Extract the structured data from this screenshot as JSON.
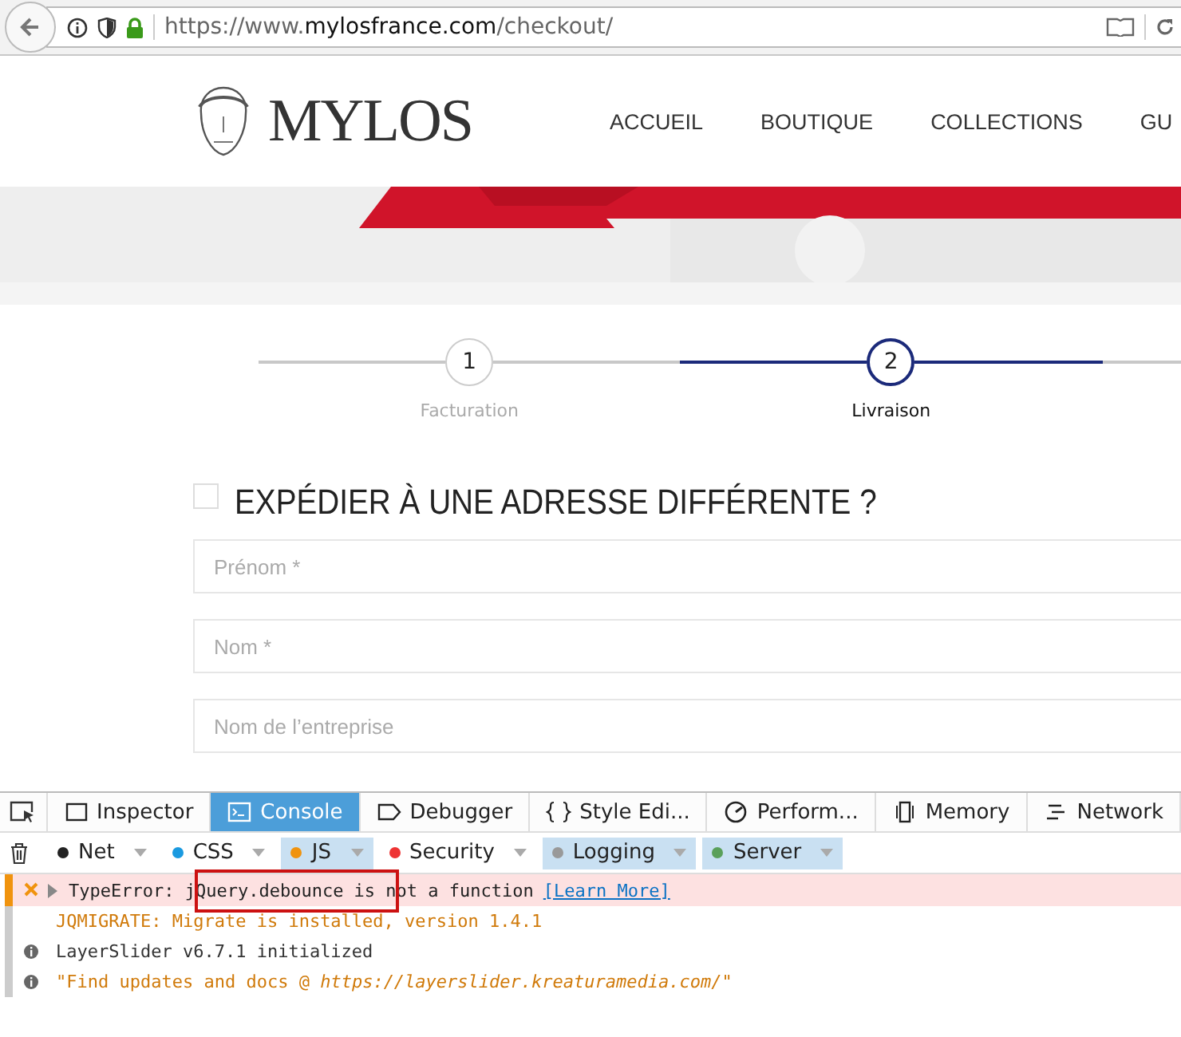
{
  "browser": {
    "url_prefix": "https://www.",
    "url_domain": "mylosfrance.com",
    "url_path": "/checkout/"
  },
  "site": {
    "logo": "MYLOS",
    "nav": [
      "ACCUEIL",
      "BOUTIQUE",
      "COLLECTIONS",
      "GU"
    ]
  },
  "steps": [
    {
      "number": "1",
      "label": "Facturation",
      "selected": false
    },
    {
      "number": "2",
      "label": "Livraison",
      "selected": true
    }
  ],
  "ship_elsewhere": {
    "label": "EXPÉDIER À UNE ADRESSE DIFFÉRENTE ?",
    "checked": false
  },
  "fields": [
    {
      "placeholder": "Prénom *"
    },
    {
      "placeholder": "Nom *"
    },
    {
      "placeholder": "Nom de l’entreprise"
    }
  ],
  "devtools": {
    "tabs": [
      {
        "label": "Inspector",
        "kind": "inspector",
        "selected": false
      },
      {
        "label": "Console",
        "kind": "console",
        "selected": true
      },
      {
        "label": "Debugger",
        "kind": "debugger",
        "selected": false
      },
      {
        "label": "Style Edi...",
        "kind": "style",
        "selected": false
      },
      {
        "label": "Perform...",
        "kind": "perf",
        "selected": false
      },
      {
        "label": "Memory",
        "kind": "memory",
        "selected": false
      },
      {
        "label": "Network",
        "kind": "network",
        "selected": false
      }
    ],
    "filters": [
      {
        "label": "Net",
        "color": "#222222",
        "selected": false
      },
      {
        "label": "CSS",
        "color": "#1a9ae0",
        "selected": false
      },
      {
        "label": "JS",
        "color": "#f0930e",
        "selected": true
      },
      {
        "label": "Security",
        "color": "#ee3333",
        "selected": false
      },
      {
        "label": "Logging",
        "color": "#999999",
        "selected": true
      },
      {
        "label": "Server",
        "color": "#5aa05a",
        "selected": true
      }
    ],
    "messages": [
      {
        "kind": "error",
        "text": "TypeError: jQuery.debounce is not a function",
        "link": "[Learn More]"
      },
      {
        "kind": "warning",
        "text": "JQMIGRATE: Migrate is installed, version 1.4.1",
        "color": "#d07a0a"
      },
      {
        "kind": "info",
        "text": "LayerSlider v6.7.1 initialized",
        "color": "#333333"
      },
      {
        "kind": "info",
        "text": "\"Find updates and docs @ *https://layerslider.kreaturamedia.com/*\"",
        "color": "#d07a0a"
      }
    ]
  }
}
